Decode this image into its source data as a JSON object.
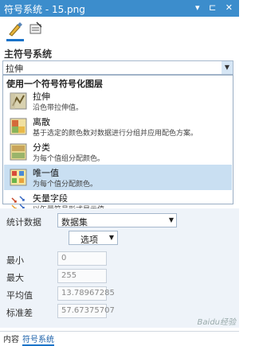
{
  "window": {
    "title": "符号系统 - 15.png",
    "controls": "▾ ⊏ ✕"
  },
  "section": {
    "title": "主符号系统"
  },
  "primary_dropdown": {
    "value": "拉伸"
  },
  "popup": {
    "header": "使用一个符号符号化图层",
    "options": [
      {
        "name": "拉伸",
        "desc": "沿色带拉伸值。"
      },
      {
        "name": "离散",
        "desc": "基于选定的颜色数对数据进行分组并应用配色方案。"
      },
      {
        "name": "分类",
        "desc": "为每个值组分配颜色。"
      },
      {
        "name": "唯一值",
        "desc": "为每个值分配颜色。",
        "selected": true
      },
      {
        "name": "矢量字段",
        "desc": "以矢量符号形式显示值。"
      }
    ]
  },
  "stats": {
    "stat_label": "统计数据",
    "stat_value": "数据集",
    "options_label": "选项",
    "min_label": "最小",
    "min_value": "0",
    "max_label": "最大",
    "max_value": "255",
    "mean_label": "平均值",
    "mean_value": "13.78967285",
    "std_label": "标准差",
    "std_value": "57.67375707"
  },
  "bottom_tabs": {
    "content": "内容",
    "symbology": "符号系统"
  },
  "watermark": {
    "text": "Baidu经验"
  },
  "colors": {
    "accent": "#3c8dcc",
    "highlight": "#c9dff2",
    "callout": "#d6202c"
  }
}
